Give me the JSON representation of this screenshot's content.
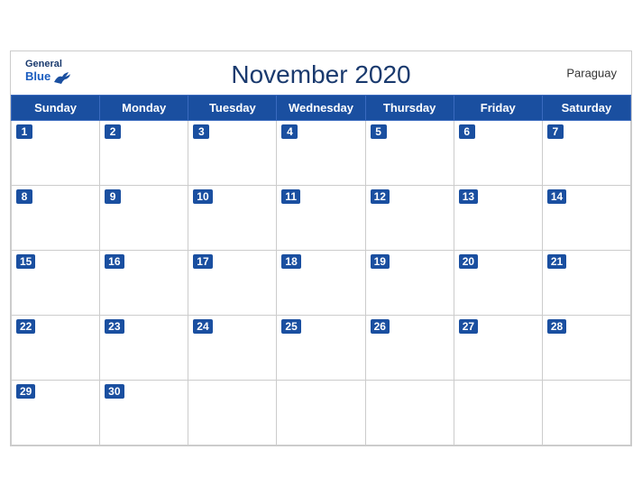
{
  "header": {
    "logo_general": "General",
    "logo_blue": "Blue",
    "title": "November 2020",
    "country": "Paraguay"
  },
  "weekdays": [
    "Sunday",
    "Monday",
    "Tuesday",
    "Wednesday",
    "Thursday",
    "Friday",
    "Saturday"
  ],
  "weeks": [
    [
      {
        "day": 1,
        "has_date": true
      },
      {
        "day": 2,
        "has_date": true
      },
      {
        "day": 3,
        "has_date": true
      },
      {
        "day": 4,
        "has_date": true
      },
      {
        "day": 5,
        "has_date": true
      },
      {
        "day": 6,
        "has_date": true
      },
      {
        "day": 7,
        "has_date": true
      }
    ],
    [
      {
        "day": 8,
        "has_date": true
      },
      {
        "day": 9,
        "has_date": true
      },
      {
        "day": 10,
        "has_date": true
      },
      {
        "day": 11,
        "has_date": true
      },
      {
        "day": 12,
        "has_date": true
      },
      {
        "day": 13,
        "has_date": true
      },
      {
        "day": 14,
        "has_date": true
      }
    ],
    [
      {
        "day": 15,
        "has_date": true
      },
      {
        "day": 16,
        "has_date": true
      },
      {
        "day": 17,
        "has_date": true
      },
      {
        "day": 18,
        "has_date": true
      },
      {
        "day": 19,
        "has_date": true
      },
      {
        "day": 20,
        "has_date": true
      },
      {
        "day": 21,
        "has_date": true
      }
    ],
    [
      {
        "day": 22,
        "has_date": true
      },
      {
        "day": 23,
        "has_date": true
      },
      {
        "day": 24,
        "has_date": true
      },
      {
        "day": 25,
        "has_date": true
      },
      {
        "day": 26,
        "has_date": true
      },
      {
        "day": 27,
        "has_date": true
      },
      {
        "day": 28,
        "has_date": true
      }
    ],
    [
      {
        "day": 29,
        "has_date": true
      },
      {
        "day": 30,
        "has_date": true
      },
      {
        "day": null,
        "has_date": false
      },
      {
        "day": null,
        "has_date": false
      },
      {
        "day": null,
        "has_date": false
      },
      {
        "day": null,
        "has_date": false
      },
      {
        "day": null,
        "has_date": false
      }
    ]
  ]
}
